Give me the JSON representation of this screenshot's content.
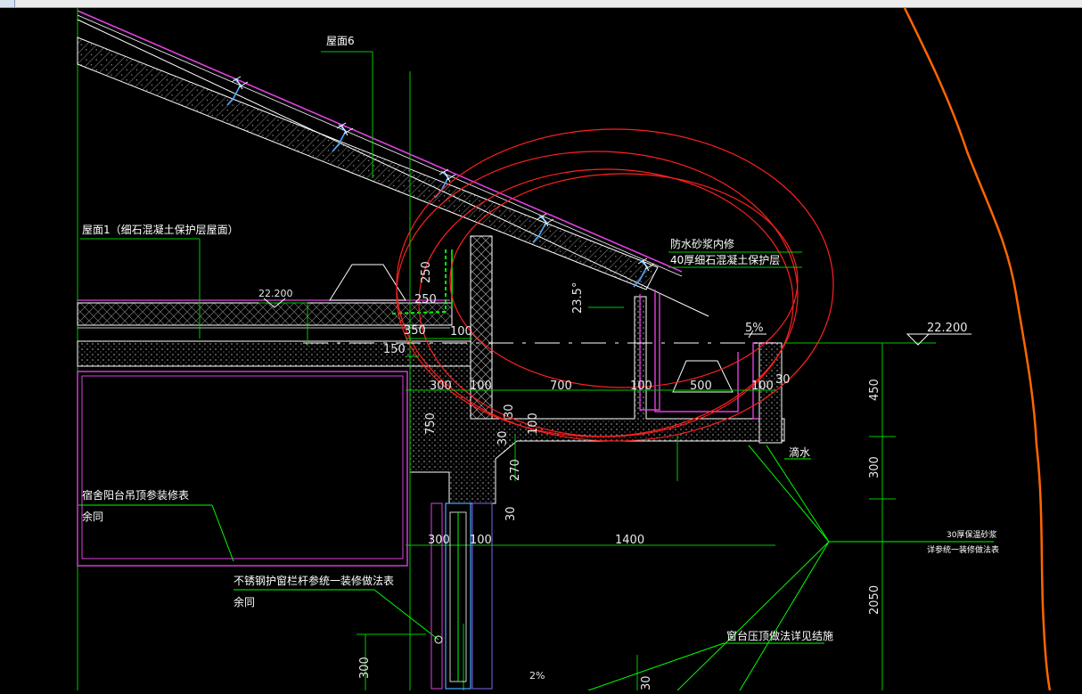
{
  "window": {
    "toolbar_visible": true
  },
  "colors": {
    "background": "#000000",
    "structure": "#ffffff",
    "dimension_line": "#00c800",
    "leader": "#00ff00",
    "roof_line": "#e040e0",
    "revision_cloud": "#ff2020",
    "boundary": "#ff6600",
    "steel": "#4aa8ff"
  },
  "annotations": {
    "roof6": "屋面6",
    "roof1": "屋面1（细石混凝土保护层屋面）",
    "waterproof_mortar": "防水砂浆内修",
    "concrete_protect": "40厚细石混凝土保护层",
    "drip": "滴水",
    "dorm_ceiling": "宿舍阳台吊顶参装修表",
    "same_note_1": "余同",
    "railing": "不锈钢护窗栏杆参统一装修做法表",
    "same_note_2": "余同",
    "sill_note": "窗台压顶做法详见结施",
    "mortar_30": "30厚保温砂浆",
    "mortar_30_ref": "详参统一装修做法表"
  },
  "levels": {
    "left": "22.200",
    "right": "22.200"
  },
  "slope": {
    "angle": "23.5°",
    "pct": "5%",
    "pct_bottom": "2%"
  },
  "dimensions": {
    "d250a": "250",
    "d250b": "250",
    "d350": "350",
    "d100_top": "100",
    "d150": "150",
    "d300": "300",
    "d100a": "100",
    "d700": "700",
    "d100b": "100",
    "d500": "500",
    "d100c": "100",
    "d30a": "30",
    "d750": "750",
    "d30b": "30",
    "d100d": "100",
    "d30c": "30",
    "d270": "270",
    "d30d": "30",
    "d300_bottom": "300",
    "d100_bottom": "100",
    "d1400": "1400",
    "d450": "450",
    "d300_right": "300",
    "d2050": "2050",
    "d300_left_bottom": "300",
    "d30_bottom": "30"
  }
}
